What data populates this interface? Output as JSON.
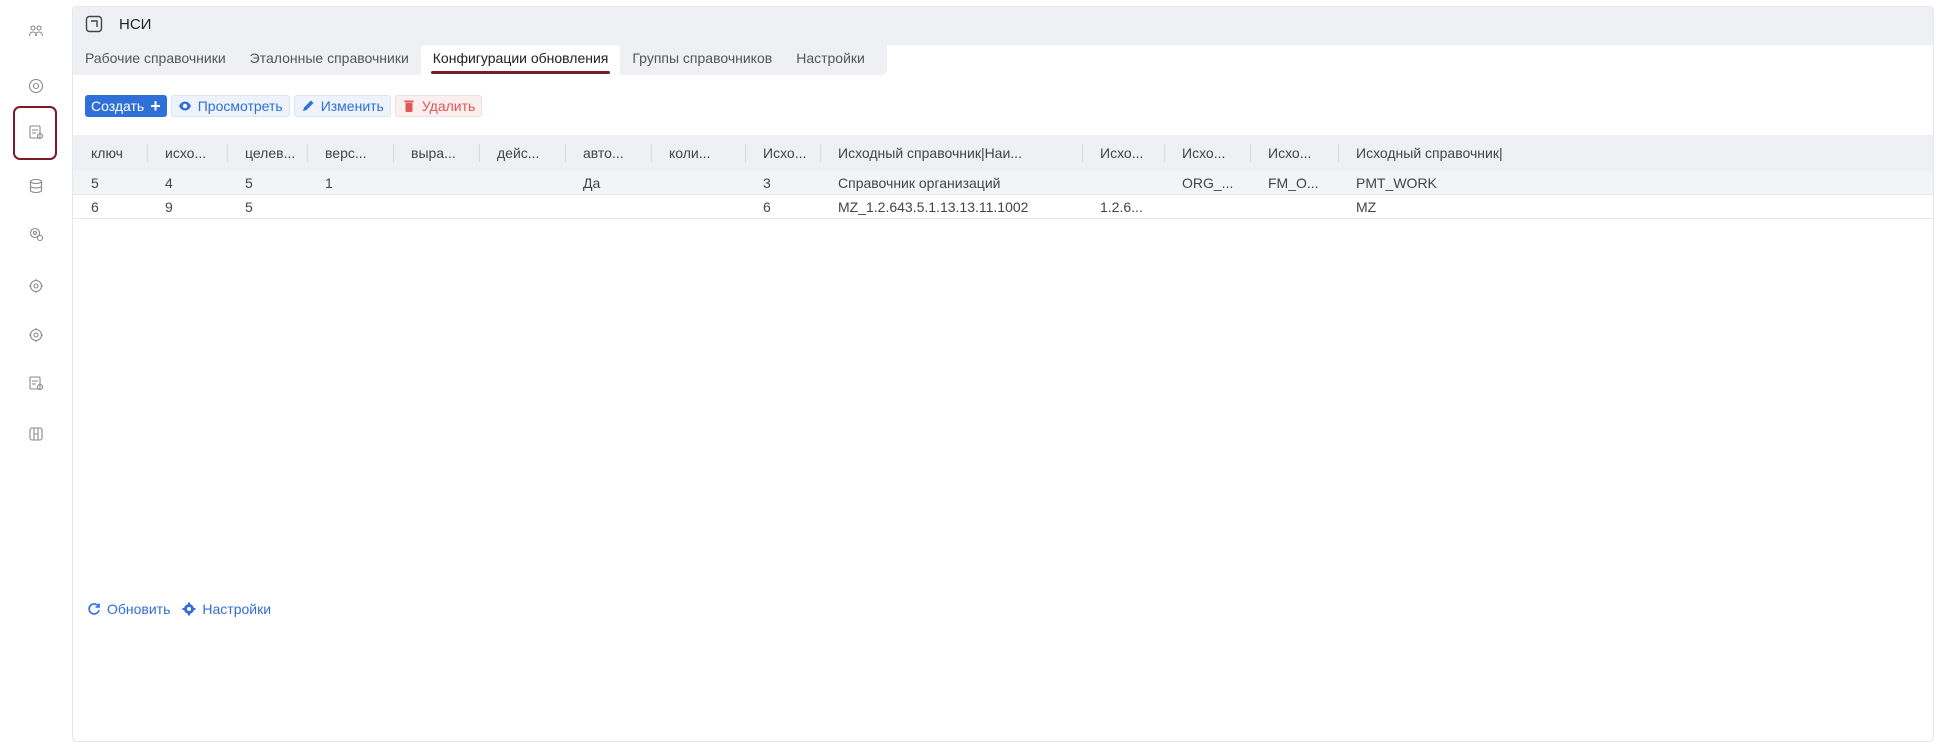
{
  "window": {
    "title": "НСИ",
    "title_icon": "expand-icon"
  },
  "rail": {
    "icons": [
      "people-icon",
      "eye-circle-icon",
      "table-clock-icon",
      "database-icon",
      "gear-clock-icon",
      "gear-icon",
      "gear-icon",
      "table-clock-icon",
      "server-icon"
    ],
    "active_index": 2,
    "highlight_color": "#7a1b28"
  },
  "tabs": [
    {
      "label": "Рабочие справочники",
      "active": false
    },
    {
      "label": "Эталонные справочники",
      "active": false
    },
    {
      "label": "Конфигурации обновления",
      "active": true
    },
    {
      "label": "Группы справочников",
      "active": false
    },
    {
      "label": "Настройки",
      "active": false
    }
  ],
  "toolbar": {
    "create_label": "Создать",
    "view_label": "Просмотреть",
    "edit_label": "Изменить",
    "delete_label": "Удалить"
  },
  "table": {
    "columns": [
      "ключ",
      "исхо...",
      "целев...",
      "верс...",
      "выра...",
      "дейс...",
      "авто...",
      "коли...",
      "Исхо...",
      "Исходный справочник|Наи...",
      "Исхо...",
      "Исхо...",
      "Исхо...",
      "Исходный справочник|"
    ],
    "rows": [
      [
        "5",
        "4",
        "5",
        "1",
        "",
        "",
        "Да",
        "",
        "3",
        "Справочник организаций",
        "",
        "ORG_...",
        "FM_O...",
        "PMT_WORK"
      ],
      [
        "6",
        "9",
        "5",
        "",
        "",
        "",
        "",
        "",
        "6",
        "MZ_1.2.643.5.1.13.13.11.1002",
        "1.2.6...",
        "",
        "",
        "MZ"
      ]
    ]
  },
  "footer": {
    "refresh_label": "Обновить",
    "settings_label": "Настройки"
  },
  "colors": {
    "accent": "#2f6fd8",
    "danger": "#e05555",
    "active_tab_underline": "#7a1b28",
    "header_bg": "#eef0f3"
  }
}
